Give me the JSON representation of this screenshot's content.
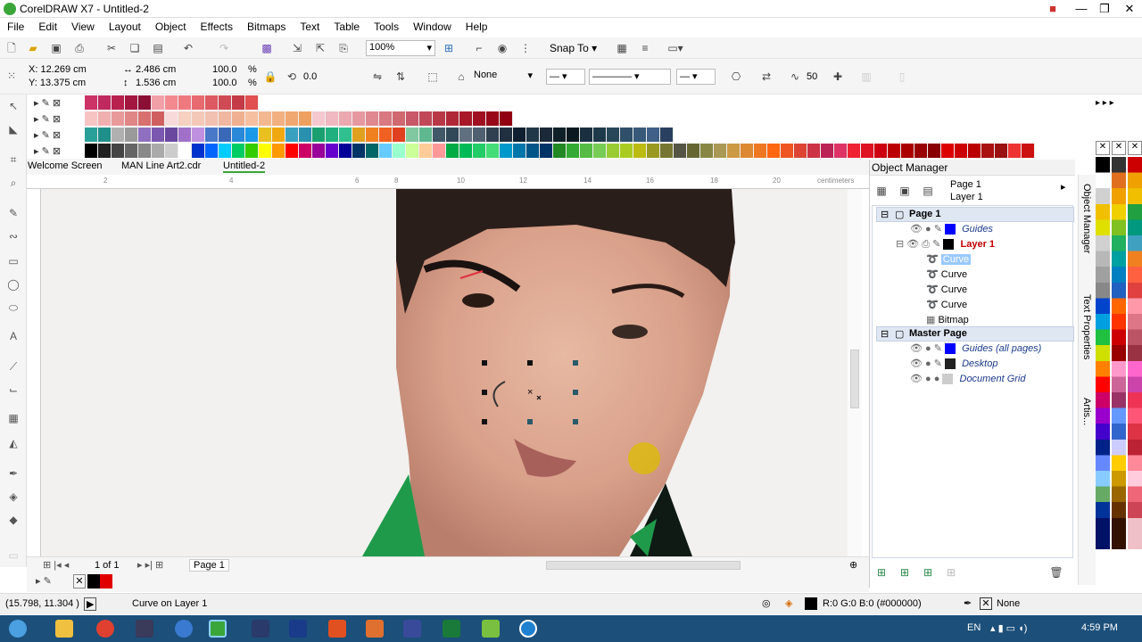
{
  "window": {
    "title": "CorelDRAW X7 - Untitled-2"
  },
  "menu": [
    "File",
    "Edit",
    "View",
    "Layout",
    "Object",
    "Effects",
    "Bitmaps",
    "Text",
    "Table",
    "Tools",
    "Window",
    "Help"
  ],
  "toolbar": {
    "zoom": "100%",
    "snap_to": "Snap To",
    "rotation_value": "50"
  },
  "property_bar": {
    "x": "X: 12.269 cm",
    "y": "Y: 13.375 cm",
    "width": "2.486 cm",
    "height": "1.536 cm",
    "scale_x": "100.0",
    "scale_y": "100.0",
    "pct": "%",
    "angle": "0.0",
    "wrap": "None",
    "smooth": "50"
  },
  "tabs": [
    "Welcome Screen",
    "MAN Line Art2.cdr",
    "Untitled-2"
  ],
  "ruler_unit": "centimeters",
  "ruler_ticks": [
    "2",
    "4",
    "6",
    "8",
    "10",
    "12",
    "14",
    "16",
    "18",
    "20"
  ],
  "page_nav": {
    "count": "1 of 1",
    "page": "Page 1"
  },
  "object_manager": {
    "title": "Object Manager",
    "current_page": "Page 1",
    "current_layer": "Layer 1",
    "tree": {
      "page1": "Page 1",
      "guides": "Guides",
      "layer1": "Layer 1",
      "items": [
        "Curve",
        "Curve",
        "Curve",
        "Curve",
        "Bitmap"
      ],
      "master": "Master Page",
      "master_items": [
        "Guides (all pages)",
        "Desktop",
        "Document Grid"
      ]
    },
    "side_tabs": [
      "Object Manager",
      "Text Properties",
      "Artis..."
    ]
  },
  "status": {
    "coords": "(15.798, 11.304 )",
    "info": "Curve on Layer 1",
    "fill": "R:0 G:0 B:0 (#000000)",
    "outline": "None"
  },
  "taskbar": {
    "lang": "EN",
    "time": "4:59 PM"
  },
  "colors": {
    "accent": "#3aa639",
    "selection": "#dfe7f3",
    "layer_red": "#c00000"
  }
}
